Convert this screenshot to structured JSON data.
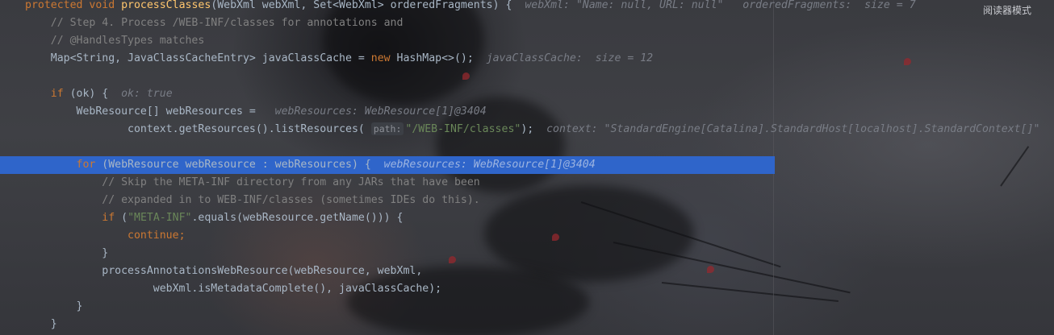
{
  "editor": {
    "reader_mode_label": "阅读器模式",
    "lines": [
      {
        "indent": "",
        "segments": [
          {
            "t": "protected ",
            "c": "kw"
          },
          {
            "t": "void ",
            "c": "kw"
          },
          {
            "t": "processClasses",
            "c": "fn"
          },
          {
            "t": "(WebXml webXml, Set<WebXml> orderedFragments) {",
            "c": ""
          },
          {
            "t": "  webXml: \"Name: null, URL: null\"   orderedFragments:  size = 7",
            "c": "hint"
          }
        ]
      },
      {
        "indent": "    ",
        "segments": [
          {
            "t": "// Step 4. Process /WEB-INF/classes for annotations and",
            "c": "cm"
          }
        ]
      },
      {
        "indent": "    ",
        "segments": [
          {
            "t": "// @HandlesTypes matches",
            "c": "cm"
          }
        ]
      },
      {
        "indent": "    ",
        "segments": [
          {
            "t": "Map<String, JavaClassCacheEntry> javaClassCache = ",
            "c": ""
          },
          {
            "t": "new ",
            "c": "kw"
          },
          {
            "t": "HashMap<>();",
            "c": ""
          },
          {
            "t": "  javaClassCache:  size = 12",
            "c": "hint"
          }
        ]
      },
      {
        "indent": "",
        "segments": []
      },
      {
        "indent": "    ",
        "segments": [
          {
            "t": "if ",
            "c": "kw"
          },
          {
            "t": "(ok) {",
            "c": ""
          },
          {
            "t": "  ok: true",
            "c": "hint"
          }
        ]
      },
      {
        "indent": "        ",
        "segments": [
          {
            "t": "WebResource[] webResources = ",
            "c": ""
          },
          {
            "t": "  webResources: WebResource[1]@3404",
            "c": "hint"
          }
        ]
      },
      {
        "indent": "                ",
        "segments": [
          {
            "t": "context.",
            "c": ""
          },
          {
            "t": "getResources",
            "c": ""
          },
          {
            "t": "().listResources( ",
            "c": ""
          },
          {
            "t": "path:",
            "c": "param"
          },
          {
            "t": "\"/WEB-INF/classes\"",
            "c": "str"
          },
          {
            "t": ");",
            "c": ""
          },
          {
            "t": "  context: \"StandardEngine[Catalina].StandardHost[localhost].StandardContext[]\"",
            "c": "hint"
          }
        ]
      },
      {
        "indent": "",
        "segments": []
      },
      {
        "indent": "        ",
        "current": true,
        "segments": [
          {
            "t": "for ",
            "c": "kw"
          },
          {
            "t": "(WebResource webResource : webResources) {",
            "c": ""
          },
          {
            "t": "  webResources: WebResource[1]@3404",
            "c": "hint cur"
          }
        ]
      },
      {
        "indent": "            ",
        "segments": [
          {
            "t": "// Skip the META-INF directory from any JARs that have been",
            "c": "cm"
          }
        ]
      },
      {
        "indent": "            ",
        "segments": [
          {
            "t": "// expanded in to WEB-INF/classes (sometimes IDEs do this).",
            "c": "cm"
          }
        ]
      },
      {
        "indent": "            ",
        "segments": [
          {
            "t": "if ",
            "c": "kw"
          },
          {
            "t": "(",
            "c": ""
          },
          {
            "t": "\"META-INF\"",
            "c": "str"
          },
          {
            "t": ".equals(webResource.getName())) {",
            "c": ""
          }
        ]
      },
      {
        "indent": "                ",
        "segments": [
          {
            "t": "continue;",
            "c": "kw"
          }
        ]
      },
      {
        "indent": "            ",
        "segments": [
          {
            "t": "}",
            "c": ""
          }
        ]
      },
      {
        "indent": "            ",
        "segments": [
          {
            "t": "processAnnotationsWebResource(webResource, webXml,",
            "c": ""
          }
        ]
      },
      {
        "indent": "                    ",
        "segments": [
          {
            "t": "webXml.isMetadataComplete(), javaClassCache);",
            "c": ""
          }
        ]
      },
      {
        "indent": "        ",
        "segments": [
          {
            "t": "}",
            "c": ""
          }
        ]
      },
      {
        "indent": "    ",
        "segments": [
          {
            "t": "}",
            "c": ""
          }
        ]
      }
    ]
  },
  "colors": {
    "keyword": "#cc7832",
    "method_decl": "#ffc66d",
    "string": "#6a8759",
    "comment": "#808080",
    "text": "#a9b7c6",
    "inline_hint": "#787c85",
    "current_line": "#2f65ca"
  }
}
